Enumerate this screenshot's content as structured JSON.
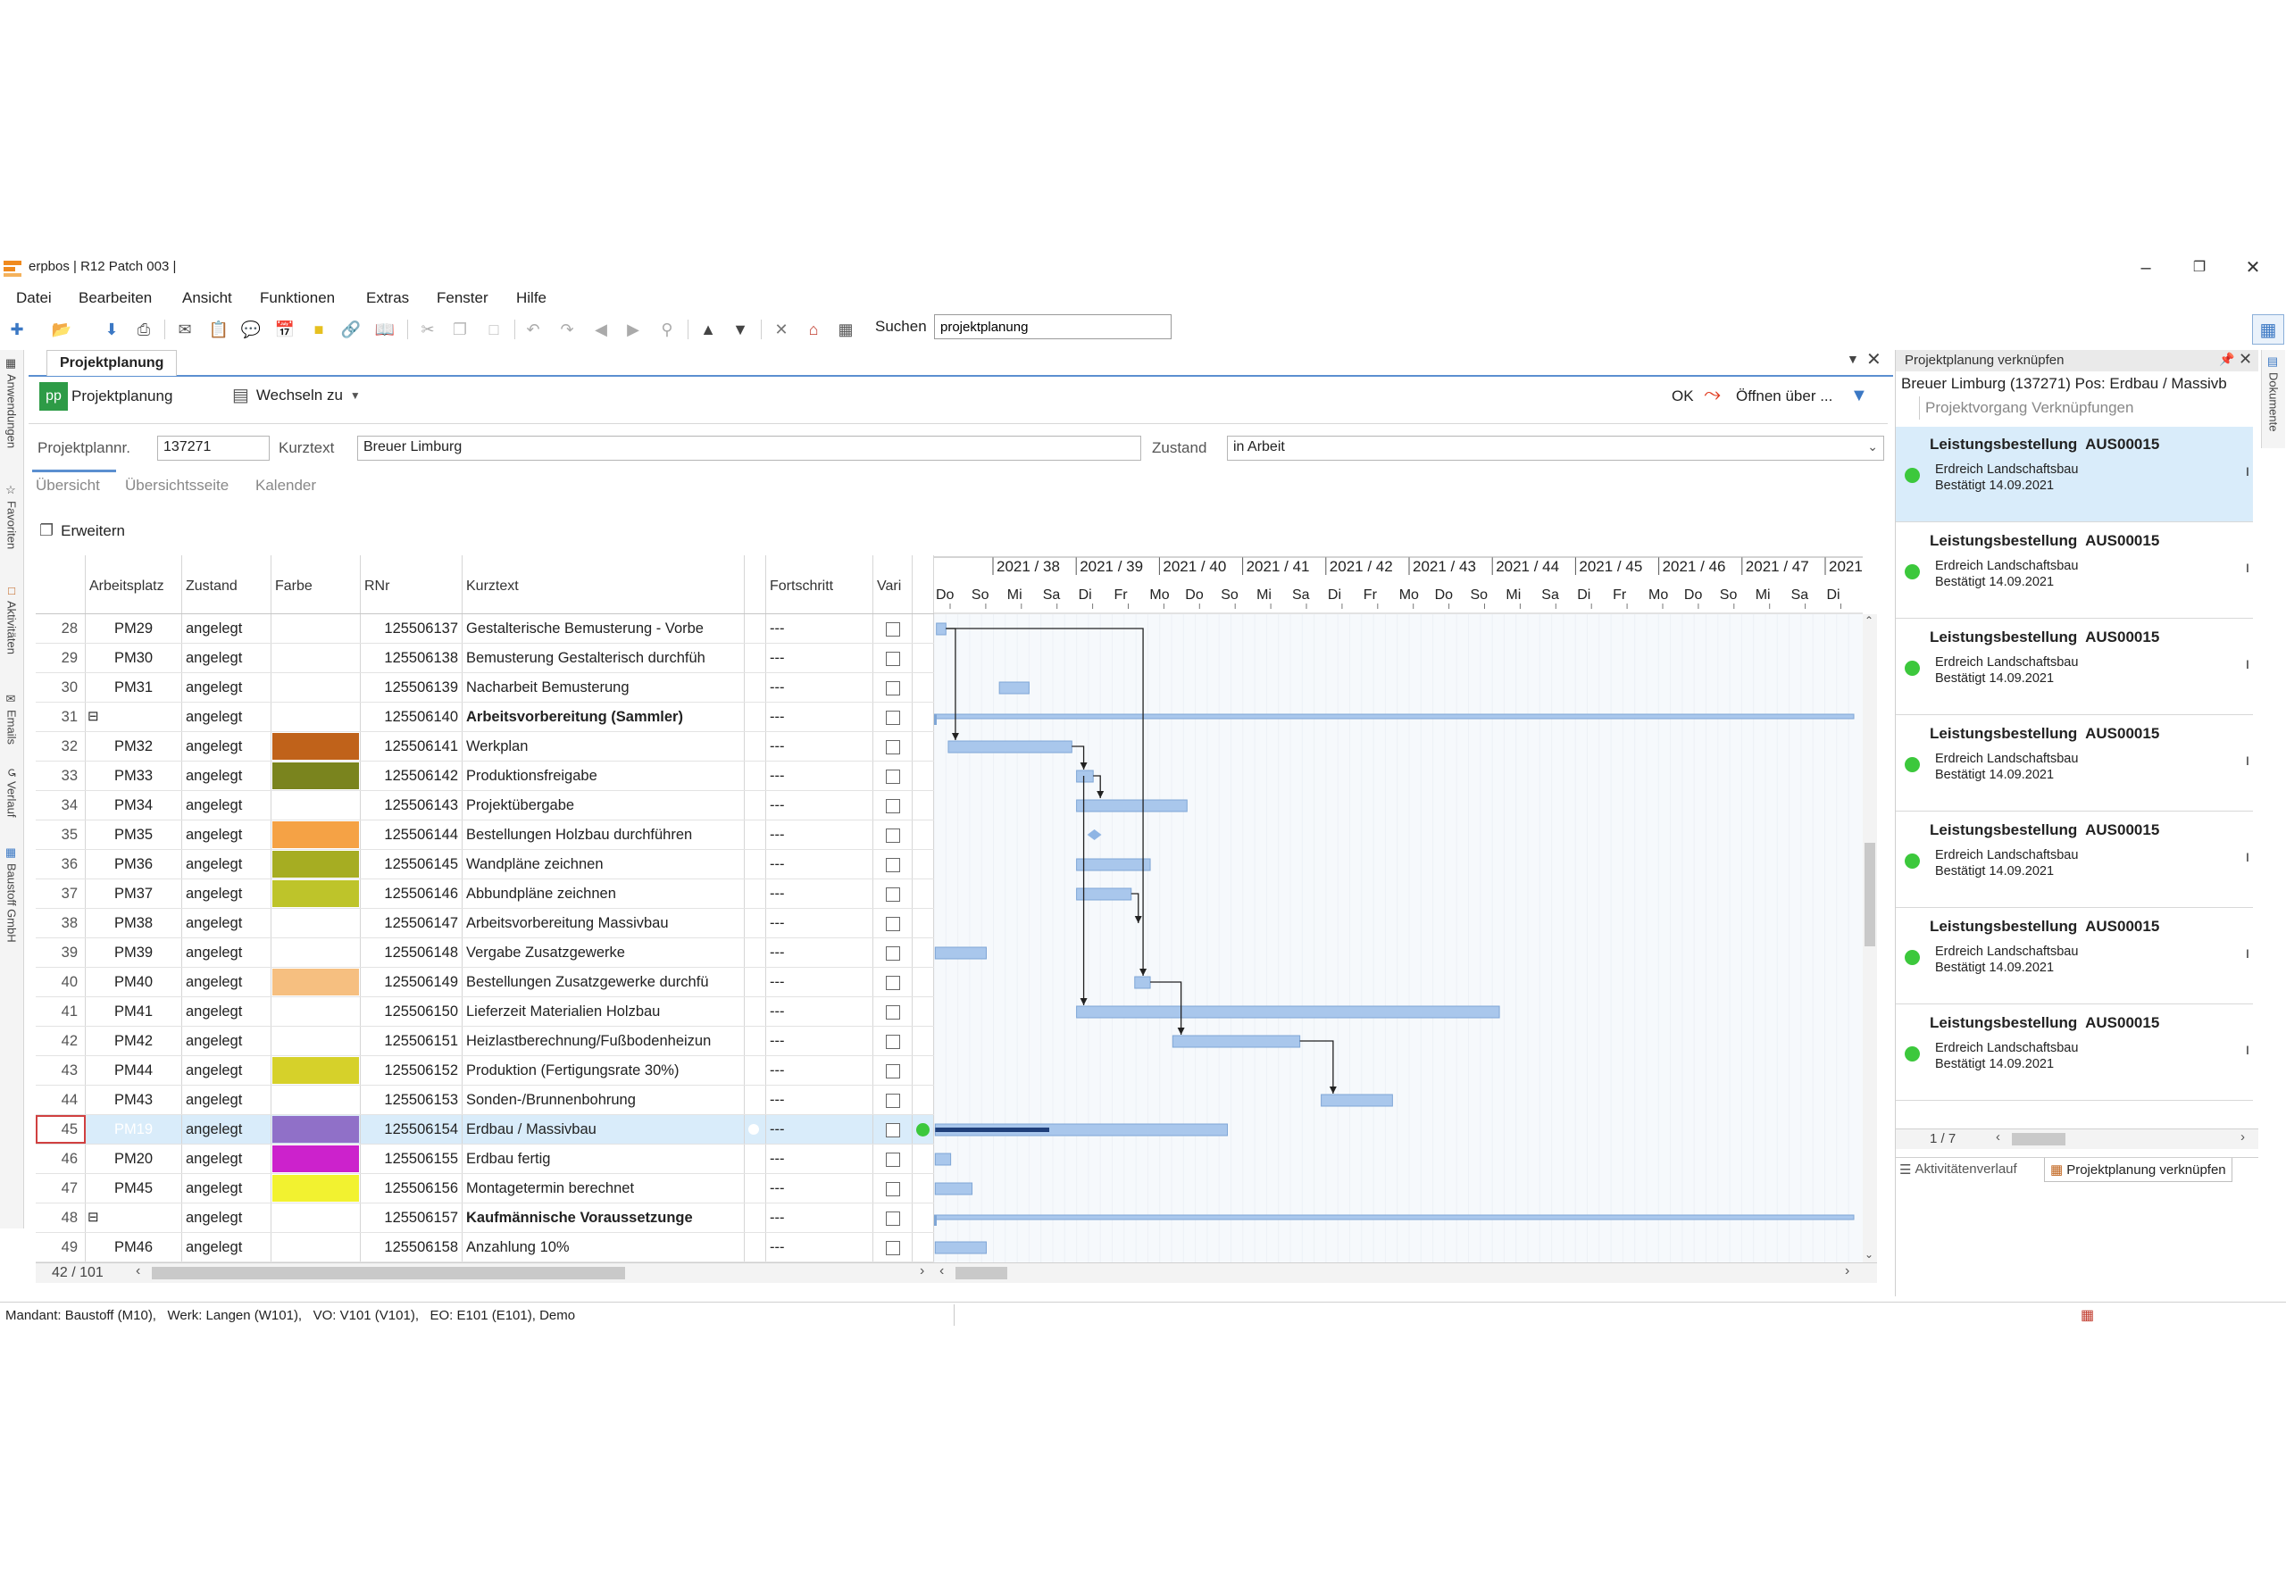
{
  "window": {
    "title": "erpbos | R12 Patch 003 |"
  },
  "menu": [
    "Datei",
    "Bearbeiten",
    "Ansicht",
    "Funktionen",
    "Extras",
    "Fenster",
    "Hilfe"
  ],
  "search": {
    "label": "Suchen",
    "value": "projektplanung"
  },
  "left_tabs": [
    "Anwendungen",
    "Favoriten",
    "Aktivitäten",
    "Emails",
    "Verlauf",
    "Baustoff GmbH"
  ],
  "right_tabs": [
    "Dokumente"
  ],
  "main_tab": "Projektplanung",
  "panel": {
    "icon_text": "pp",
    "title": "Projektplanung",
    "switch_label": "Wechseln zu",
    "ok_label": "OK",
    "open_via_label": "Öffnen über ..."
  },
  "form": {
    "plan_label": "Projektplannr.",
    "plan_value": "137271",
    "text_label": "Kurztext",
    "text_value": "Breuer Limburg",
    "state_label": "Zustand",
    "state_value": "in Arbeit"
  },
  "subtabs": [
    "Übersicht",
    "Übersichtsseite",
    "Kalender"
  ],
  "expand_label": "Erweitern",
  "columns": {
    "workplace": "Arbeitsplatz",
    "state": "Zustand",
    "color": "Farbe",
    "rnr": "RNr",
    "text": "Kurztext",
    "progress": "Fortschritt",
    "vari": "Vari"
  },
  "gantt": {
    "weeks": [
      "2021 / 38",
      "2021 / 39",
      "2021 / 40",
      "2021 / 41",
      "2021 / 42",
      "2021 / 43",
      "2021 / 44",
      "2021 / 45",
      "2021 / 46",
      "2021 / 47",
      "2021"
    ],
    "days": [
      "Do",
      "So",
      "Mi",
      "Sa",
      "Di",
      "Fr",
      "Mo",
      "Do",
      "So",
      "Mi",
      "Sa",
      "Di",
      "Fr",
      "Mo",
      "Do",
      "So",
      "Mi",
      "Sa",
      "Di",
      "Fr",
      "Mo",
      "Do",
      "So",
      "Mi",
      "Sa",
      "Di"
    ]
  },
  "rows": [
    {
      "n": "28",
      "wp": "PM29",
      "state": "angelegt",
      "color": "",
      "rnr": "125506137",
      "text": "Gestalterische Bemusterung - Vorbe",
      "bold": false,
      "prog": "---"
    },
    {
      "n": "29",
      "wp": "PM30",
      "state": "angelegt",
      "color": "",
      "rnr": "125506138",
      "text": "Bemusterung Gestalterisch durchfüh",
      "bold": false,
      "prog": "---"
    },
    {
      "n": "30",
      "wp": "PM31",
      "state": "angelegt",
      "color": "",
      "rnr": "125506139",
      "text": "Nacharbeit Bemusterung",
      "bold": false,
      "prog": "---"
    },
    {
      "n": "31",
      "wp": "",
      "state": "angelegt",
      "color": "",
      "rnr": "125506140",
      "text": "Arbeitsvorbereitung (Sammler)",
      "bold": true,
      "prog": "---",
      "group": true
    },
    {
      "n": "32",
      "wp": "PM32",
      "state": "angelegt",
      "color": "#c0621a",
      "rnr": "125506141",
      "text": "Werkplan",
      "bold": false,
      "prog": "---"
    },
    {
      "n": "33",
      "wp": "PM33",
      "state": "angelegt",
      "color": "#7a841e",
      "rnr": "125506142",
      "text": "Produktionsfreigabe",
      "bold": false,
      "prog": "---"
    },
    {
      "n": "34",
      "wp": "PM34",
      "state": "angelegt",
      "color": "",
      "rnr": "125506143",
      "text": "Projektübergabe",
      "bold": false,
      "prog": "---"
    },
    {
      "n": "35",
      "wp": "PM35",
      "state": "angelegt",
      "color": "#f5a245",
      "rnr": "125506144",
      "text": "Bestellungen Holzbau durchführen",
      "bold": false,
      "prog": "---"
    },
    {
      "n": "36",
      "wp": "PM36",
      "state": "angelegt",
      "color": "#a6ad22",
      "rnr": "125506145",
      "text": "Wandpläne zeichnen",
      "bold": false,
      "prog": "---"
    },
    {
      "n": "37",
      "wp": "PM37",
      "state": "angelegt",
      "color": "#bec42a",
      "rnr": "125506146",
      "text": "Abbundpläne zeichnen",
      "bold": false,
      "prog": "---"
    },
    {
      "n": "38",
      "wp": "PM38",
      "state": "angelegt",
      "color": "",
      "rnr": "125506147",
      "text": "Arbeitsvorbereitung Massivbau",
      "bold": false,
      "prog": "---"
    },
    {
      "n": "39",
      "wp": "PM39",
      "state": "angelegt",
      "color": "",
      "rnr": "125506148",
      "text": "Vergabe Zusatzgewerke",
      "bold": false,
      "prog": "---"
    },
    {
      "n": "40",
      "wp": "PM40",
      "state": "angelegt",
      "color": "#f6bf80",
      "rnr": "125506149",
      "text": "Bestellungen Zusatzgewerke durchfü",
      "bold": false,
      "prog": "---"
    },
    {
      "n": "41",
      "wp": "PM41",
      "state": "angelegt",
      "color": "",
      "rnr": "125506150",
      "text": "Lieferzeit Materialien Holzbau",
      "bold": false,
      "prog": "---"
    },
    {
      "n": "42",
      "wp": "PM42",
      "state": "angelegt",
      "color": "",
      "rnr": "125506151",
      "text": "Heizlastberechnung/Fußbodenheizun",
      "bold": false,
      "prog": "---"
    },
    {
      "n": "43",
      "wp": "PM44",
      "state": "angelegt",
      "color": "#d6d12a",
      "rnr": "125506152",
      "text": "Produktion (Fertigungsrate 30%)",
      "bold": false,
      "prog": "---"
    },
    {
      "n": "44",
      "wp": "PM43",
      "state": "angelegt",
      "color": "",
      "rnr": "125506153",
      "text": "Sonden-/Brunnenbohrung",
      "bold": false,
      "prog": "---"
    },
    {
      "n": "45",
      "wp": "PM19",
      "state": "angelegt",
      "color": "#9070c8",
      "rnr": "125506154",
      "text": "Erdbau / Massivbau",
      "bold": false,
      "prog": "---",
      "selected": true
    },
    {
      "n": "46",
      "wp": "PM20",
      "state": "angelegt",
      "color": "#cc22cc",
      "rnr": "125506155",
      "text": "Erdbau fertig",
      "bold": false,
      "prog": "---"
    },
    {
      "n": "47",
      "wp": "PM45",
      "state": "angelegt",
      "color": "#f2f230",
      "rnr": "125506156",
      "text": "Montagetermin berechnet",
      "bold": false,
      "prog": "---"
    },
    {
      "n": "48",
      "wp": "",
      "state": "angelegt",
      "color": "",
      "rnr": "125506157",
      "text": "Kaufmännische Voraussetzunge",
      "bold": true,
      "prog": "---",
      "group": true
    },
    {
      "n": "49",
      "wp": "PM46",
      "state": "angelegt",
      "color": "",
      "rnr": "125506158",
      "text": "Anzahlung 10%",
      "bold": false,
      "prog": "---"
    }
  ],
  "grid_footer": {
    "counter": "42 / 101"
  },
  "right_panel": {
    "title": "Projektplanung verknüpfen",
    "subtitle": "Breuer Limburg (137271) Pos: Erdbau / Massivb",
    "list_header": "Projektvorgang Verknüpfungen",
    "items": [
      {
        "title": "Leistungsbestellung  AUS00015",
        "line1": "Erdreich Landschaftsbau",
        "line2": "Bestätigt 14.09.2021",
        "mark": "I",
        "highlighted": true
      },
      {
        "title": "Leistungsbestellung  AUS00015",
        "line1": "Erdreich Landschaftsbau",
        "line2": "Bestätigt 14.09.2021",
        "mark": "I"
      },
      {
        "title": "Leistungsbestellung  AUS00015",
        "line1": "Erdreich Landschaftsbau",
        "line2": "Bestätigt 14.09.2021",
        "mark": "I"
      },
      {
        "title": "Leistungsbestellung  AUS00015",
        "line1": "Erdreich Landschaftsbau",
        "line2": "Bestätigt 14.09.2021",
        "mark": "I"
      },
      {
        "title": "Leistungsbestellung  AUS00015",
        "line1": "Erdreich Landschaftsbau",
        "line2": "Bestätigt 14.09.2021",
        "mark": "I"
      },
      {
        "title": "Leistungsbestellung  AUS00015",
        "line1": "Erdreich Landschaftsbau",
        "line2": "Bestätigt 14.09.2021",
        "mark": "I"
      },
      {
        "title": "Leistungsbestellung  AUS00015",
        "line1": "Erdreich Landschaftsbau",
        "line2": "Bestätigt 14.09.2021",
        "mark": "I"
      }
    ],
    "pager": "1 / 7",
    "bottom_tabs": [
      "Aktivitätenverlauf",
      "Projektplanung verknüpfen"
    ]
  },
  "status_bar": {
    "text": "Mandant: Baustoff (M10),   Werk: Langen (W101),   VO: V101 (V101),   EO: E101 (E101), Demo"
  },
  "colors": {
    "accent": "#5b8fd0",
    "bar": "#a9c7ec",
    "bar_border": "#7fa6d6",
    "selection": "#d9ecfa",
    "status_green": "#3cc83c",
    "logo": "#f08a1e",
    "icon_green": "#2d9b46"
  }
}
